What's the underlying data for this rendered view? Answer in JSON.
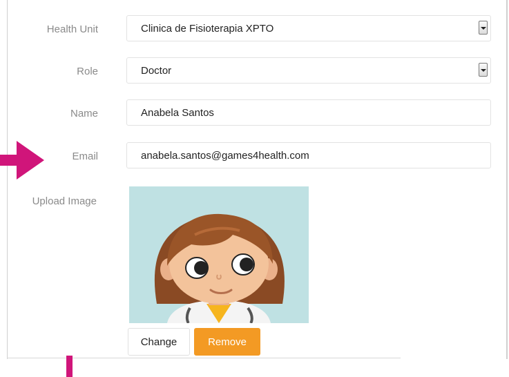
{
  "form": {
    "health_unit": {
      "label": "Health Unit",
      "value": "Clinica de Fisioterapia XPTO"
    },
    "role": {
      "label": "Role",
      "value": "Doctor"
    },
    "name": {
      "label": "Name",
      "value": "Anabela Santos"
    },
    "email": {
      "label": "Email",
      "value": "anabela.santos@games4health.com"
    },
    "upload": {
      "label": "Upload Image"
    }
  },
  "buttons": {
    "change": "Change",
    "remove": "Remove"
  },
  "colors": {
    "accent_arrow": "#d0157a",
    "remove_button": "#f39a24",
    "avatar_bg": "#bfe1e3"
  },
  "icons": {
    "select_toggle": "chevron-down-icon",
    "annotation": "arrow-right-icon"
  }
}
